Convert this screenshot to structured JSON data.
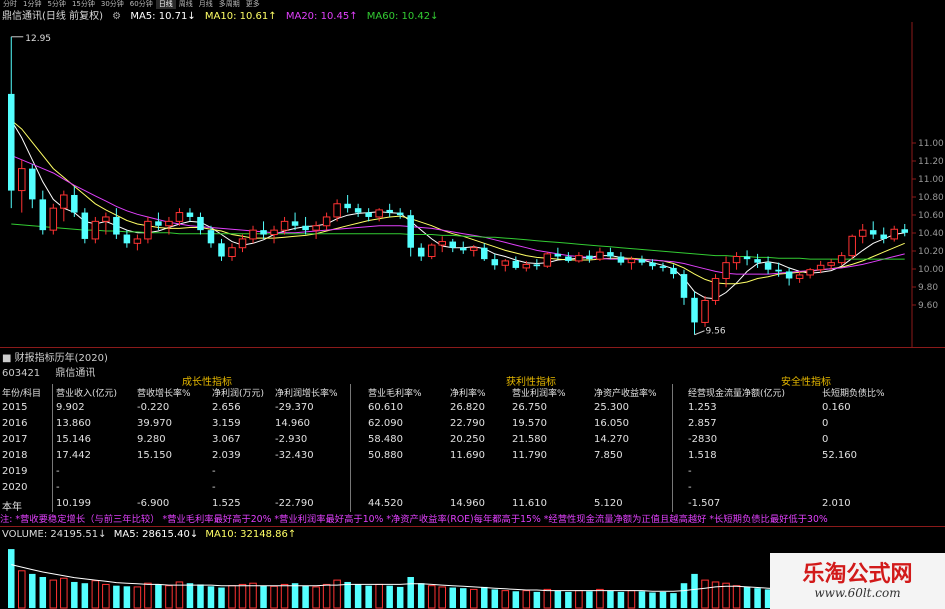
{
  "toolbar": {
    "periods": [
      "分时",
      "1分钟",
      "5分钟",
      "15分钟",
      "30分钟",
      "60分钟",
      "日线",
      "周线",
      "月线",
      "多周期",
      "更多"
    ],
    "active": "日线"
  },
  "legend": {
    "stock": "鼎信通讯(日线 前复权)",
    "ma5": "MA5: 10.71↓",
    "ma10": "MA10: 10.61↑",
    "ma20": "MA20: 10.45↑",
    "ma60": "MA60: 10.42↓",
    "colors": {
      "stock": "#d8d8d8",
      "ma5": "#ffffff",
      "ma10": "#ffff66",
      "ma20": "#e040fb",
      "ma60": "#33cc33"
    }
  },
  "chart_data": {
    "type": "candlestick",
    "high_label": "12.95",
    "low_label": "9.56",
    "price_axis": [
      "11.00",
      "11.20",
      "11.00",
      "10.80",
      "10.60",
      "10.40",
      "10.20",
      "10.00",
      "9.80",
      "9.60"
    ],
    "ylim": [
      9.5,
      13.05
    ],
    "up_color": "#ff3333",
    "down_color": "#54ffff",
    "candles": [
      [
        12.3,
        12.95,
        11.0,
        11.2
      ],
      [
        11.2,
        11.55,
        10.95,
        11.45
      ],
      [
        11.45,
        11.5,
        11.0,
        11.1
      ],
      [
        11.1,
        11.2,
        10.7,
        10.75
      ],
      [
        10.75,
        11.05,
        10.7,
        11.0
      ],
      [
        11.0,
        11.2,
        10.85,
        11.15
      ],
      [
        11.15,
        11.25,
        10.9,
        10.95
      ],
      [
        10.95,
        11.0,
        10.6,
        10.65
      ],
      [
        10.65,
        10.9,
        10.6,
        10.85
      ],
      [
        10.85,
        10.95,
        10.7,
        10.9
      ],
      [
        10.9,
        11.0,
        10.65,
        10.7
      ],
      [
        10.7,
        10.75,
        10.55,
        10.6
      ],
      [
        10.6,
        10.7,
        10.52,
        10.65
      ],
      [
        10.65,
        10.9,
        10.6,
        10.85
      ],
      [
        10.85,
        10.95,
        10.75,
        10.8
      ],
      [
        10.8,
        10.9,
        10.7,
        10.85
      ],
      [
        10.85,
        11.0,
        10.8,
        10.95
      ],
      [
        10.95,
        11.0,
        10.85,
        10.9
      ],
      [
        10.9,
        10.95,
        10.7,
        10.75
      ],
      [
        10.75,
        10.8,
        10.55,
        10.6
      ],
      [
        10.6,
        10.65,
        10.4,
        10.45
      ],
      [
        10.45,
        10.6,
        10.4,
        10.55
      ],
      [
        10.55,
        10.7,
        10.5,
        10.65
      ],
      [
        10.65,
        10.8,
        10.6,
        10.75
      ],
      [
        10.75,
        10.85,
        10.65,
        10.7
      ],
      [
        10.7,
        10.8,
        10.6,
        10.75
      ],
      [
        10.75,
        10.9,
        10.7,
        10.85
      ],
      [
        10.85,
        10.95,
        10.75,
        10.8
      ],
      [
        10.8,
        10.9,
        10.7,
        10.75
      ],
      [
        10.75,
        10.85,
        10.65,
        10.8
      ],
      [
        10.8,
        10.95,
        10.75,
        10.9
      ],
      [
        10.9,
        11.1,
        10.85,
        11.05
      ],
      [
        11.05,
        11.15,
        10.95,
        11.0
      ],
      [
        11.0,
        11.05,
        10.9,
        10.95
      ],
      [
        10.95,
        11.0,
        10.85,
        10.9
      ],
      [
        10.9,
        11.0,
        10.85,
        10.98
      ],
      [
        10.98,
        11.05,
        10.9,
        10.95
      ],
      [
        10.95,
        11.0,
        10.88,
        10.92
      ],
      [
        10.92,
        10.98,
        10.45,
        10.55
      ],
      [
        10.55,
        10.6,
        10.4,
        10.45
      ],
      [
        10.45,
        10.6,
        10.42,
        10.58
      ],
      [
        10.58,
        10.68,
        10.5,
        10.62
      ],
      [
        10.62,
        10.65,
        10.5,
        10.55
      ],
      [
        10.55,
        10.62,
        10.48,
        10.52
      ],
      [
        10.52,
        10.58,
        10.45,
        10.55
      ],
      [
        10.55,
        10.6,
        10.4,
        10.42
      ],
      [
        10.42,
        10.48,
        10.3,
        10.35
      ],
      [
        10.35,
        10.42,
        10.28,
        10.4
      ],
      [
        10.4,
        10.45,
        10.3,
        10.32
      ],
      [
        10.32,
        10.4,
        10.28,
        10.36
      ],
      [
        10.36,
        10.42,
        10.3,
        10.34
      ],
      [
        10.34,
        10.5,
        10.32,
        10.48
      ],
      [
        10.48,
        10.55,
        10.42,
        10.45
      ],
      [
        10.45,
        10.5,
        10.38,
        10.4
      ],
      [
        10.4,
        10.5,
        10.38,
        10.46
      ],
      [
        10.46,
        10.52,
        10.38,
        10.42
      ],
      [
        10.42,
        10.55,
        10.4,
        10.5
      ],
      [
        10.5,
        10.55,
        10.42,
        10.45
      ],
      [
        10.45,
        10.5,
        10.35,
        10.38
      ],
      [
        10.38,
        10.45,
        10.3,
        10.42
      ],
      [
        10.42,
        10.46,
        10.35,
        10.38
      ],
      [
        10.38,
        10.42,
        10.3,
        10.34
      ],
      [
        10.34,
        10.38,
        10.28,
        10.32
      ],
      [
        10.32,
        10.36,
        10.2,
        10.25
      ],
      [
        10.25,
        10.3,
        9.9,
        9.98
      ],
      [
        9.98,
        10.05,
        9.56,
        9.7
      ],
      [
        9.7,
        10.0,
        9.65,
        9.95
      ],
      [
        9.95,
        10.25,
        9.9,
        10.2
      ],
      [
        10.2,
        10.45,
        10.1,
        10.38
      ],
      [
        10.38,
        10.5,
        10.3,
        10.45
      ],
      [
        10.45,
        10.52,
        10.35,
        10.42
      ],
      [
        10.42,
        10.48,
        10.32,
        10.38
      ],
      [
        10.38,
        10.45,
        10.25,
        10.3
      ],
      [
        10.3,
        10.38,
        10.22,
        10.28
      ],
      [
        10.28,
        10.32,
        10.12,
        10.2
      ],
      [
        10.2,
        10.28,
        10.15,
        10.24
      ],
      [
        10.24,
        10.32,
        10.2,
        10.3
      ],
      [
        10.3,
        10.4,
        10.26,
        10.35
      ],
      [
        10.35,
        10.42,
        10.3,
        10.38
      ],
      [
        10.38,
        10.5,
        10.35,
        10.46
      ],
      [
        10.46,
        10.7,
        10.42,
        10.68
      ],
      [
        10.68,
        10.82,
        10.6,
        10.75
      ],
      [
        10.75,
        10.85,
        10.65,
        10.7
      ],
      [
        10.7,
        10.78,
        10.6,
        10.65
      ],
      [
        10.65,
        10.8,
        10.62,
        10.76
      ],
      [
        10.76,
        10.82,
        10.68,
        10.72
      ]
    ],
    "ma": [
      {
        "name": "MA5",
        "color": "#ffffff",
        "values": [
          12.0,
          11.8,
          11.55,
          11.3,
          11.1,
          11.0,
          10.95,
          10.85,
          10.82,
          10.85,
          10.8,
          10.75,
          10.72,
          10.72,
          10.74,
          10.78,
          10.82,
          10.85,
          10.84,
          10.78,
          10.7,
          10.62,
          10.58,
          10.6,
          10.64,
          10.7,
          10.74,
          10.77,
          10.79,
          10.8,
          10.82,
          10.88,
          10.92,
          10.94,
          10.95,
          10.96,
          10.95,
          10.94,
          10.85,
          10.75,
          10.65,
          10.57,
          10.55,
          10.55,
          10.56,
          10.54,
          10.48,
          10.45,
          10.41,
          10.38,
          10.37,
          10.38,
          10.41,
          10.42,
          10.43,
          10.44,
          10.46,
          10.46,
          10.44,
          10.42,
          10.41,
          10.38,
          10.35,
          10.31,
          10.2,
          10.05,
          9.98,
          9.97,
          10.04,
          10.15,
          10.28,
          10.37,
          10.39,
          10.37,
          10.32,
          10.28,
          10.26,
          10.27,
          10.29,
          10.34,
          10.43,
          10.52,
          10.6,
          10.65,
          10.7,
          10.72
        ]
      },
      {
        "name": "MA10",
        "color": "#ffff66",
        "values": [
          12.0,
          11.9,
          11.75,
          11.6,
          11.45,
          11.35,
          11.25,
          11.15,
          11.05,
          10.98,
          10.92,
          10.86,
          10.82,
          10.8,
          10.78,
          10.77,
          10.77,
          10.78,
          10.78,
          10.76,
          10.74,
          10.7,
          10.68,
          10.66,
          10.66,
          10.66,
          10.67,
          10.68,
          10.69,
          10.71,
          10.74,
          10.77,
          10.8,
          10.83,
          10.86,
          10.88,
          10.9,
          10.91,
          10.88,
          10.84,
          10.8,
          10.75,
          10.71,
          10.68,
          10.64,
          10.6,
          10.56,
          10.52,
          10.49,
          10.46,
          10.44,
          10.43,
          10.42,
          10.41,
          10.41,
          10.41,
          10.42,
          10.43,
          10.43,
          10.43,
          10.42,
          10.41,
          10.4,
          10.37,
          10.32,
          10.25,
          10.19,
          10.15,
          10.14,
          10.14,
          10.16,
          10.2,
          10.22,
          10.25,
          10.26,
          10.27,
          10.28,
          10.3,
          10.31,
          10.33,
          10.36,
          10.4,
          10.45,
          10.5,
          10.55,
          10.6
        ]
      },
      {
        "name": "MA20",
        "color": "#e040fb",
        "values": [
          11.6,
          11.55,
          11.5,
          11.45,
          11.4,
          11.33,
          11.26,
          11.2,
          11.14,
          11.08,
          11.02,
          10.97,
          10.93,
          10.9,
          10.87,
          10.84,
          10.82,
          10.8,
          10.79,
          10.78,
          10.77,
          10.76,
          10.75,
          10.74,
          10.73,
          10.72,
          10.72,
          10.72,
          10.73,
          10.74,
          10.75,
          10.76,
          10.77,
          10.78,
          10.79,
          10.8,
          10.8,
          10.8,
          10.79,
          10.78,
          10.77,
          10.75,
          10.73,
          10.71,
          10.69,
          10.67,
          10.64,
          10.61,
          10.58,
          10.55,
          10.52,
          10.5,
          10.48,
          10.46,
          10.45,
          10.44,
          10.43,
          10.42,
          10.42,
          10.42,
          10.41,
          10.41,
          10.4,
          10.39,
          10.37,
          10.34,
          10.31,
          10.28,
          10.26,
          10.25,
          10.25,
          10.25,
          10.25,
          10.26,
          10.27,
          10.28,
          10.29,
          10.3,
          10.31,
          10.32,
          10.34,
          10.36,
          10.39,
          10.42,
          10.45,
          10.48
        ]
      },
      {
        "name": "MA60",
        "color": "#33cc33",
        "values": [
          10.82,
          10.81,
          10.8,
          10.79,
          10.78,
          10.77,
          10.76,
          10.75,
          10.75,
          10.74,
          10.74,
          10.73,
          10.73,
          10.72,
          10.72,
          10.72,
          10.71,
          10.71,
          10.71,
          10.71,
          10.71,
          10.71,
          10.71,
          10.71,
          10.71,
          10.71,
          10.71,
          10.71,
          10.71,
          10.71,
          10.71,
          10.71,
          10.71,
          10.71,
          10.71,
          10.71,
          10.71,
          10.71,
          10.7,
          10.7,
          10.7,
          10.69,
          10.69,
          10.68,
          10.68,
          10.67,
          10.67,
          10.66,
          10.65,
          10.64,
          10.63,
          10.62,
          10.61,
          10.6,
          10.59,
          10.58,
          10.57,
          10.56,
          10.55,
          10.54,
          10.53,
          10.52,
          10.51,
          10.5,
          10.49,
          10.48,
          10.47,
          10.46,
          10.46,
          10.45,
          10.45,
          10.44,
          10.44,
          10.43,
          10.43,
          10.43,
          10.42,
          10.42,
          10.42,
          10.42,
          10.42,
          10.42,
          10.42,
          10.42,
          10.42,
          10.42
        ]
      }
    ]
  },
  "fin": {
    "title": "■ 财报指标历年(2020)",
    "code": "603421",
    "name": "鼎信通讯",
    "groups": [
      "成长性指标",
      "获利性指标",
      "安全性指标"
    ],
    "row_header": "年份/科目",
    "headers": [
      "营业收入(亿元)",
      "营收增长率%",
      "净利润(万元)",
      "净利润增长率%",
      "营业毛利率%",
      "净利率%",
      "营业利润率%",
      "净资产收益率%",
      "经营现金流量净额(亿元)",
      "长短期负债比%"
    ],
    "rows": [
      {
        "year": "2015",
        "v": [
          "9.902",
          "-0.220",
          "2.656",
          "-29.370",
          "60.610",
          "26.820",
          "26.750",
          "25.300",
          "1.253",
          "0.160"
        ]
      },
      {
        "year": "2016",
        "v": [
          "13.860",
          "39.970",
          "3.159",
          "14.960",
          "62.090",
          "22.790",
          "19.570",
          "16.050",
          "2.857",
          "0"
        ]
      },
      {
        "year": "2017",
        "v": [
          "15.146",
          "9.280",
          "3.067",
          "-2.930",
          "58.480",
          "20.250",
          "21.580",
          "14.270",
          "-2830",
          "0"
        ]
      },
      {
        "year": "2018",
        "v": [
          "17.442",
          "15.150",
          "2.039",
          "-32.430",
          "50.880",
          "11.690",
          "11.790",
          "7.850",
          "1.518",
          "52.160"
        ]
      },
      {
        "year": "2019",
        "v": [
          "-",
          "",
          "-",
          "",
          "",
          "",
          "",
          "",
          "-",
          ""
        ]
      },
      {
        "year": "2020",
        "v": [
          "-",
          "",
          "-",
          "",
          "",
          "",
          "",
          "",
          "-",
          ""
        ]
      },
      {
        "year": "本年",
        "v": [
          "10.199",
          "-6.900",
          "1.525",
          "-22.790",
          "44.520",
          "14.960",
          "11.610",
          "5.120",
          "-1.507",
          "2.010"
        ]
      }
    ]
  },
  "note": "注: *营收要稳定增长（与前三年比较） *营业毛利率最好高于20% *营业利润率最好高于10% *净资产收益率(ROE)每年都高于15%   *经营性现金流量净额为正值且越高越好 *长短期负债比最好低于30%",
  "volume": {
    "label": "VOLUME: 24195.51↓",
    "ma5": "MA5: 28615.40↓",
    "ma10": "MA10: 32148.86↑",
    "bars": [
      95,
      60,
      55,
      50,
      45,
      48,
      42,
      40,
      44,
      38,
      36,
      35,
      34,
      40,
      38,
      36,
      42,
      40,
      38,
      35,
      33,
      36,
      38,
      40,
      36,
      35,
      38,
      40,
      36,
      34,
      38,
      45,
      42,
      38,
      36,
      38,
      36,
      34,
      50,
      40,
      36,
      34,
      33,
      32,
      30,
      34,
      30,
      28,
      27,
      28,
      26,
      30,
      28,
      26,
      28,
      27,
      30,
      28,
      26,
      28,
      27,
      25,
      26,
      24,
      40,
      55,
      45,
      42,
      40,
      36,
      34,
      32,
      30,
      30,
      28,
      27,
      28,
      26,
      27,
      28,
      38,
      36,
      34,
      32,
      30,
      28
    ],
    "ma_line": [
      70,
      66,
      62,
      58,
      55,
      52,
      49,
      47,
      45,
      43,
      41,
      40,
      39,
      38,
      38,
      37,
      37,
      37,
      37,
      37,
      36,
      36,
      36,
      36,
      36,
      36,
      36,
      36,
      36,
      36,
      37,
      37,
      38,
      38,
      38,
      38,
      38,
      38,
      39,
      39,
      38,
      37,
      36,
      35,
      34,
      33,
      32,
      31,
      30,
      29,
      29,
      28,
      28,
      28,
      28,
      28,
      28,
      28,
      28,
      28,
      28,
      27,
      27,
      27,
      28,
      30,
      32,
      34,
      35,
      35,
      34,
      33,
      32,
      31,
      31,
      30,
      30,
      29,
      29,
      29,
      30,
      31,
      32,
      32,
      31,
      31
    ]
  },
  "watermark": {
    "title": "乐淘公式网",
    "url": "www.60lt.com"
  }
}
